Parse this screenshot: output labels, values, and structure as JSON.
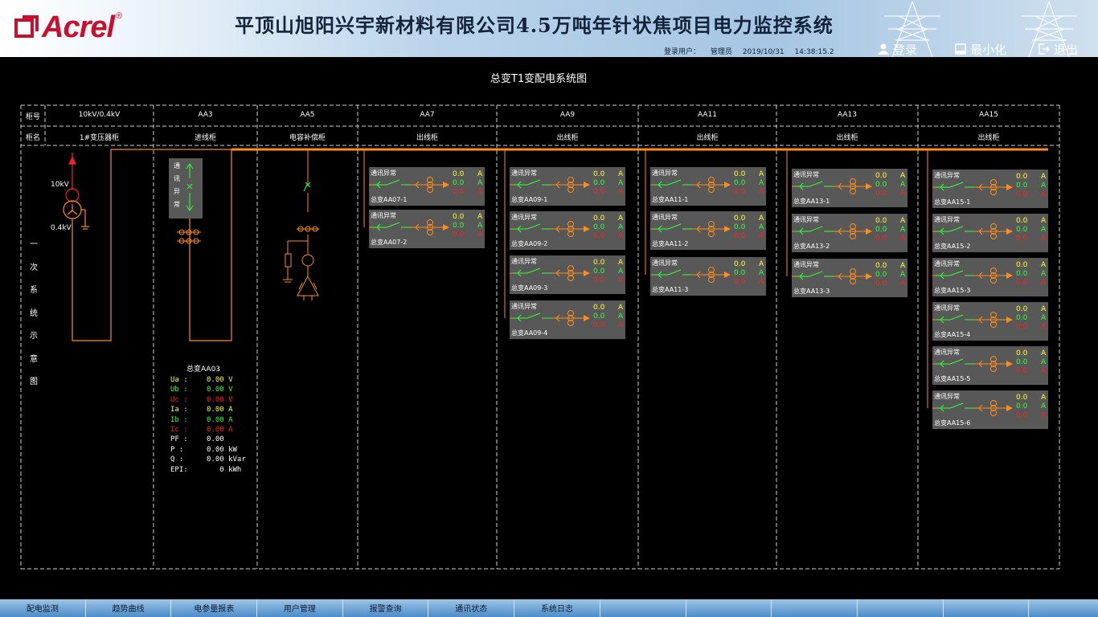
{
  "header": {
    "logo_text": "Acrel",
    "logo_reg": "®",
    "title": "平顶山旭阳兴宇新材料有限公司4.5万吨年针状焦项目电力监控系统",
    "login_user_label": "登录用户：",
    "login_user": "管理员",
    "date": "2019/10/31",
    "time": "14:38:15.2",
    "buttons": {
      "login": "登录",
      "minimize": "最小化",
      "exit": "退出"
    }
  },
  "diagram": {
    "title": "总变T1变配电系统图",
    "row_labels": {
      "cabinet_no": "柜号",
      "cabinet_name": "柜名"
    },
    "vertical_label": [
      "一",
      "次",
      "系",
      "统",
      "示",
      "意",
      "图"
    ],
    "cabinets": [
      {
        "no": "10kV/0.4kV",
        "name": "1#变压器柜"
      },
      {
        "no": "AA3",
        "name": "进线柜"
      },
      {
        "no": "AA5",
        "name": "电容补偿柜"
      },
      {
        "no": "AA7",
        "name": "出线柜"
      },
      {
        "no": "AA9",
        "name": "出线柜"
      },
      {
        "no": "AA11",
        "name": "出线柜"
      },
      {
        "no": "AA13",
        "name": "出线柜"
      },
      {
        "no": "AA15",
        "name": "出线柜"
      }
    ],
    "transformer": {
      "hv_label": "10kV",
      "lv_label": "0.4kV"
    },
    "incomer_status": [
      "通",
      "讯",
      "异",
      "常"
    ],
    "incomer_reading": {
      "name": "总变AA03",
      "rows": [
        {
          "label": "Ua :",
          "value": "0.00 V",
          "color": "#ffff33"
        },
        {
          "label": "Ub :",
          "value": "0.00 V",
          "color": "#33ff33"
        },
        {
          "label": "Uc :",
          "value": "0.00 V",
          "color": "#ff2020"
        },
        {
          "label": "Ia :",
          "value": "0.00 A",
          "color": "#ffff33"
        },
        {
          "label": "Ib :",
          "value": "0.00 A",
          "color": "#33ff33"
        },
        {
          "label": "Ic :",
          "value": "0.00 A",
          "color": "#ff2020"
        },
        {
          "label": "PF :",
          "value": "0.00",
          "color": "#ffffff"
        },
        {
          "label": "P  :",
          "value": "0.00 kW",
          "color": "#ffffff"
        },
        {
          "label": "Q  :",
          "value": "0.00 kVar",
          "color": "#ffffff"
        },
        {
          "label": "EPI:",
          "value": "   0 kWh",
          "color": "#ffffff"
        }
      ]
    },
    "feeder_status": "通讯异常",
    "feeder_values": {
      "a": "0.0",
      "b": "0.0",
      "c": "0.0",
      "unit": "A"
    },
    "feeders": [
      {
        "col": 0,
        "names": [
          "总变AA07-1",
          "总变AA07-2"
        ]
      },
      {
        "col": 1,
        "names": [
          "总变AA09-1",
          "总变AA09-2",
          "总变AA09-3",
          "总变AA09-4"
        ]
      },
      {
        "col": 2,
        "names": [
          "总变AA11-1",
          "总变AA11-2",
          "总变AA11-3"
        ]
      },
      {
        "col": 3,
        "names": [
          "总变AA13-1",
          "总变AA13-2",
          "总变AA13-3"
        ]
      },
      {
        "col": 4,
        "names": [
          "总变AA15-1",
          "总变AA15-2",
          "总变AA15-3",
          "总变AA15-4",
          "总变AA15-5",
          "总变AA15-6"
        ]
      }
    ],
    "colors": {
      "busbar": "#ff8c1a",
      "green": "#33ff33",
      "red": "#ff2020",
      "yellow": "#ffff33",
      "panel": "#585858"
    }
  },
  "nav": [
    "配电监测",
    "趋势曲线",
    "电参量报表",
    "用户管理",
    "报警查询",
    "通讯状态",
    "系统日志",
    "",
    "",
    "",
    "",
    "",
    ""
  ]
}
